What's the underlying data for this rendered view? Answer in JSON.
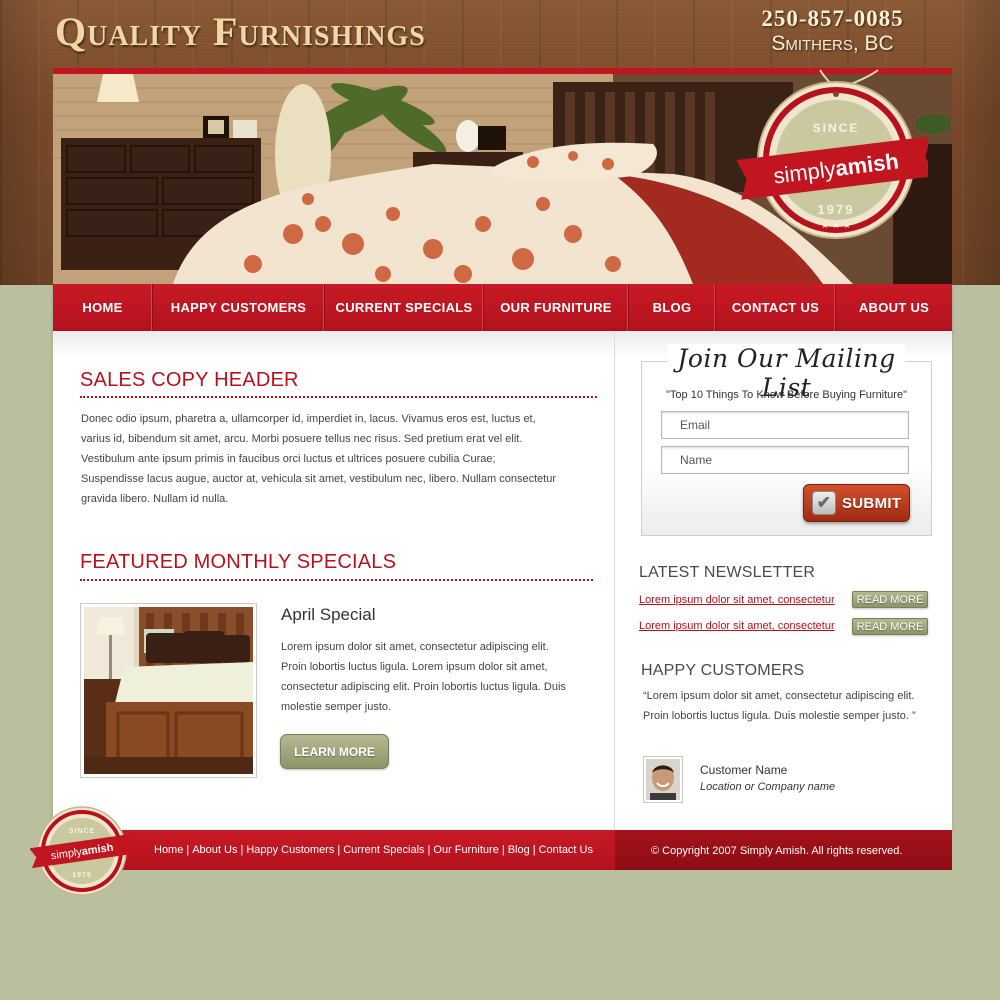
{
  "header": {
    "title": "Quality Furnishings",
    "phone": "250-857-0085",
    "city": "Smithers, BC"
  },
  "badge": {
    "since": "SINCE",
    "brand_simply": "simply",
    "brand_amish": "amish",
    "year": "1979"
  },
  "nav": {
    "items": [
      {
        "label": "HOME"
      },
      {
        "label": "HAPPY CUSTOMERS"
      },
      {
        "label": "CURRENT SPECIALS"
      },
      {
        "label": "OUR FURNITURE"
      },
      {
        "label": "BLOG"
      },
      {
        "label": "CONTACT US"
      },
      {
        "label": "ABOUT US"
      }
    ]
  },
  "sales": {
    "header": "SALES COPY HEADER",
    "lines": [
      "Donec odio ipsum, pharetra a, ullamcorper id, imperdiet in, lacus. Vivamus eros est, luctus et,",
      "varius id, bibendum sit amet, arcu. Morbi posuere tellus nec risus. Sed pretium erat vel elit.",
      "Vestibulum ante ipsum primis in faucibus orci luctus et ultrices posuere cubilia Curae;",
      "Suspendisse lacus augue, auctor at, vehicula sit amet, vestibulum nec, libero. Nullam consectetur",
      "gravida libero. Nullam id nulla."
    ]
  },
  "featured": {
    "header": "FEATURED MONTHLY SPECIALS",
    "special_title": "April Special",
    "lines": [
      "Lorem ipsum dolor sit amet, consectetur adipiscing elit.",
      "Proin lobortis luctus ligula. Lorem ipsum dolor sit amet,",
      "consectetur adipiscing elit. Proin lobortis luctus ligula. Duis",
      "molestie semper justo."
    ],
    "button_label": "LEARN MORE"
  },
  "mailing": {
    "title": "Join Our Mailing List",
    "subtitle": "\"Top 10 Things To Know Before Buying Furniture\"",
    "email_placeholder": "Email",
    "name_placeholder": "Name",
    "submit_label": "SUBMIT"
  },
  "newsletter": {
    "header": "LATEST NEWSLETTER",
    "items": [
      {
        "link": "Lorem ipsum dolor sit amet, consectetur",
        "button": "READ MORE"
      },
      {
        "link": "Lorem ipsum dolor sit amet, consectetur",
        "button": "READ MORE"
      }
    ]
  },
  "customers": {
    "header": "HAPPY CUSTOMERS",
    "quote": "“Lorem ipsum dolor sit amet, consectetur adipiscing elit. Proin lobortis luctus ligula. Duis molestie semper justo. ”",
    "name": "Customer Name",
    "location": "Location or Company name"
  },
  "footer": {
    "links": [
      "Home",
      "About Us",
      "Happy Customers",
      "Current Specials",
      "Our Furniture",
      "Blog",
      "Contact Us"
    ],
    "copyright": "© Copyright 2007 Simply Amish. All rights reserved."
  },
  "colors": {
    "brand_red": "#b7121c",
    "nav_red": "#c71a26",
    "olive": "#9a9f72",
    "page_bg": "#b9bf9f",
    "wood": "#7a4a2a"
  }
}
